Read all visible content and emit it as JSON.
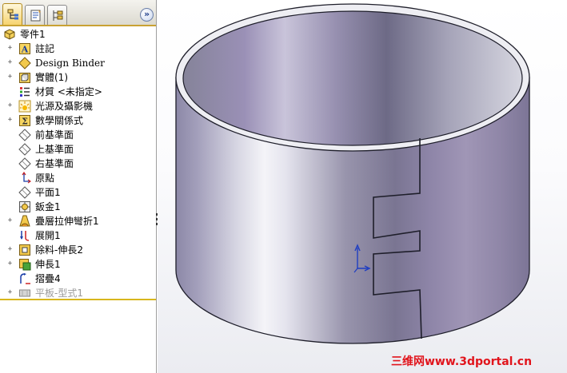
{
  "feature_manager": {
    "tabs": [
      {
        "icon": "feature-tree-icon",
        "active": true
      },
      {
        "icon": "property-manager-icon",
        "active": false
      },
      {
        "icon": "configuration-manager-icon",
        "active": false
      }
    ],
    "collapse_label": "»",
    "items": [
      {
        "label": "零件1",
        "icon": "part-icon",
        "expander": ""
      },
      {
        "label": "註記",
        "icon": "annotations-icon",
        "expander": "+"
      },
      {
        "label": "Design Binder",
        "icon": "design-binder-icon",
        "expander": "+"
      },
      {
        "label": "實體(1)",
        "icon": "solid-bodies-icon",
        "expander": "+"
      },
      {
        "label": "材質 <未指定>",
        "icon": "material-icon",
        "expander": ""
      },
      {
        "label": "光源及攝影機",
        "icon": "lights-cameras-icon",
        "expander": "+"
      },
      {
        "label": "數學關係式",
        "icon": "equations-icon",
        "expander": "+"
      },
      {
        "label": "前基準面",
        "icon": "plane-icon",
        "expander": ""
      },
      {
        "label": "上基準面",
        "icon": "plane-icon",
        "expander": ""
      },
      {
        "label": "右基準面",
        "icon": "plane-icon",
        "expander": ""
      },
      {
        "label": "原點",
        "icon": "origin-icon",
        "expander": ""
      },
      {
        "label": "平面1",
        "icon": "plane-icon",
        "expander": ""
      },
      {
        "label": "鈑金1",
        "icon": "sheet-metal-icon",
        "expander": ""
      },
      {
        "label": "疊層拉伸彎折1",
        "icon": "lofted-bend-icon",
        "expander": "+"
      },
      {
        "label": "展開1",
        "icon": "unfold-icon",
        "expander": ""
      },
      {
        "label": "除料-伸長2",
        "icon": "cut-extrude-icon",
        "expander": "+"
      },
      {
        "label": "伸長1",
        "icon": "extrude-icon",
        "expander": "+"
      },
      {
        "label": "摺疊4",
        "icon": "fold-icon",
        "expander": ""
      },
      {
        "label": "平板-型式1",
        "icon": "flat-pattern-icon",
        "expander": "+"
      }
    ]
  },
  "viewport": {
    "model": "sheet-metal-ring",
    "triad_icon": "origin-triad-icon"
  },
  "watermark": "三维网www.3dportal.cn",
  "colors": {
    "selection_bar": "#d8b61d",
    "watermark": "#e1141c",
    "edge": "#1e1e2a"
  }
}
